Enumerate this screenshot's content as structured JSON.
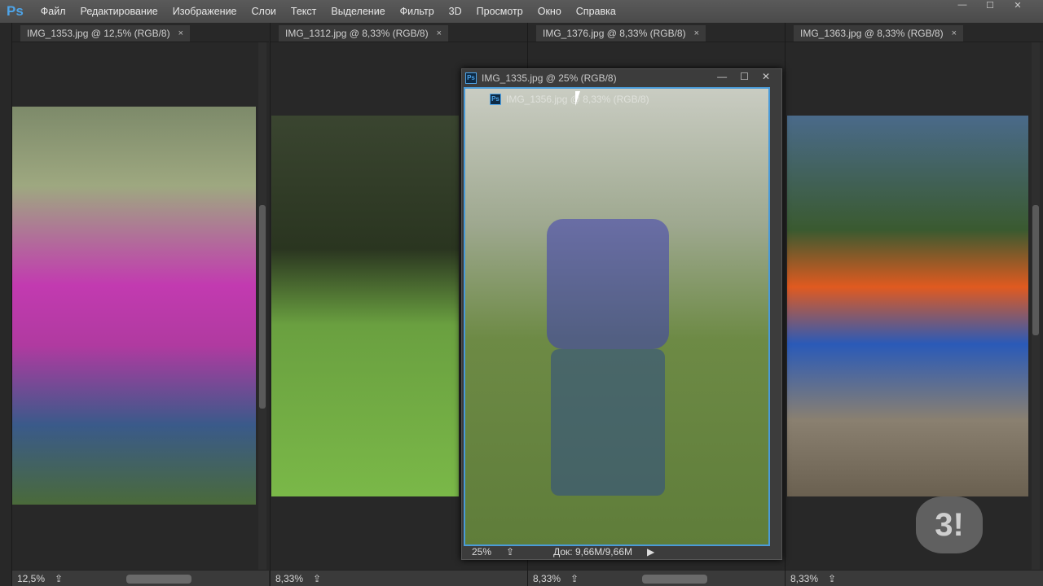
{
  "app": {
    "logo": "Ps"
  },
  "menu": [
    "Файл",
    "Редактирование",
    "Изображение",
    "Слои",
    "Текст",
    "Выделение",
    "Фильтр",
    "3D",
    "Просмотр",
    "Окно",
    "Справка"
  ],
  "window_controls": [
    "—",
    "☐",
    "✕"
  ],
  "docs": [
    {
      "title": "IMG_1353.jpg @ 12,5% (RGB/8)",
      "zoom": "12,5%"
    },
    {
      "title": "IMG_1312.jpg @ 8,33% (RGB/8)",
      "zoom": "8,33%"
    },
    {
      "title": "IMG_1376.jpg @ 8,33% (RGB/8)",
      "zoom": "8,33%"
    },
    {
      "title": "IMG_1363.jpg @ 8,33% (RGB/8)",
      "zoom": "8,33%"
    }
  ],
  "close_glyph": "×",
  "floating": {
    "title": "IMG_1335.jpg @ 25% (RGB/8)",
    "ghost_title": "IMG_1356.jpg @ 8,33% (RGB/8)",
    "zoom": "25%",
    "doc": "Док: 9,66M/9,66M",
    "controls": [
      "—",
      "☐",
      "✕"
    ]
  },
  "watermark": "3!"
}
